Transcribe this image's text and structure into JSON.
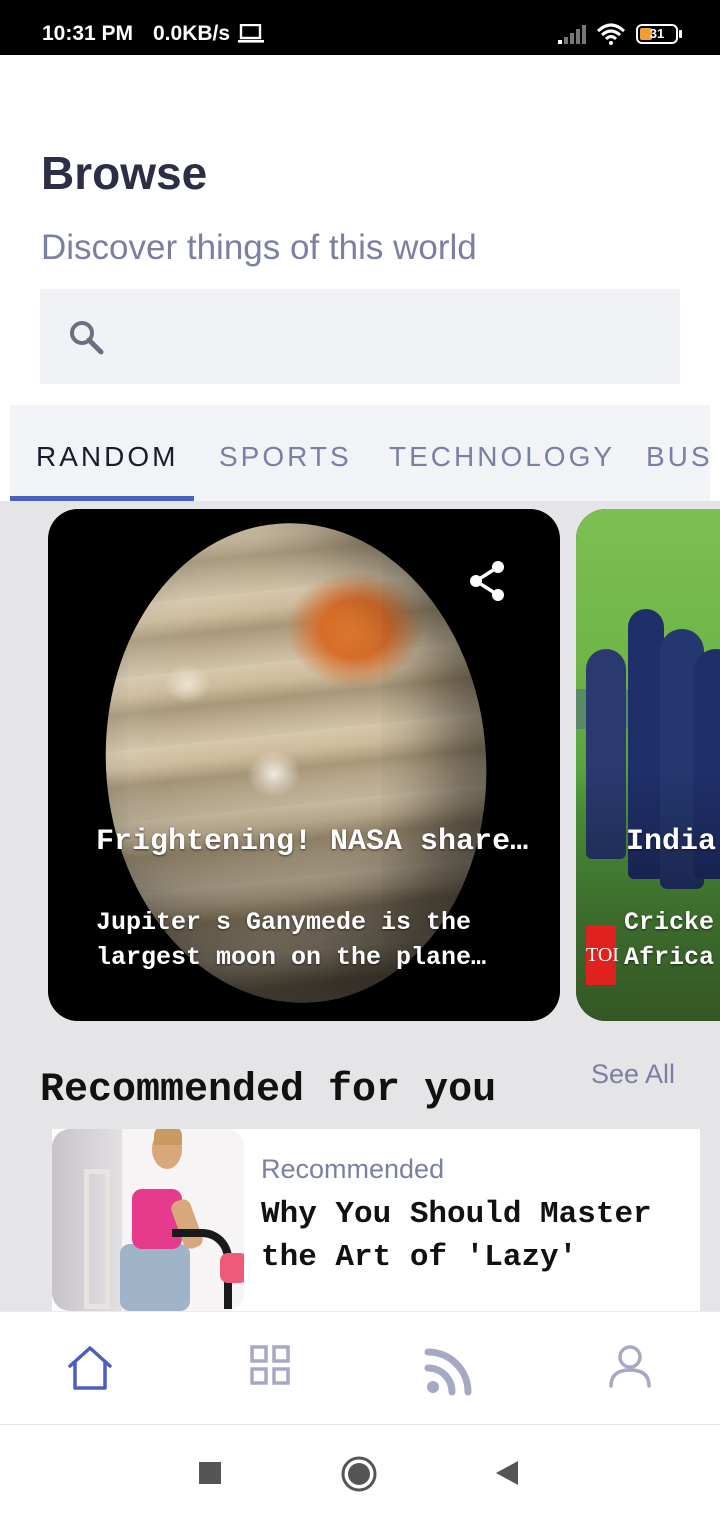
{
  "status_bar": {
    "time": "10:31 PM",
    "network_speed": "0.0KB/s",
    "battery": "31",
    "icons": [
      "laptop-icon",
      "signal-icon",
      "wifi-icon",
      "battery-icon"
    ]
  },
  "header": {
    "title": "Browse",
    "subtitle": "Discover things of this world"
  },
  "search": {
    "placeholder": "",
    "value": "",
    "icon": "search-icon"
  },
  "tabs": [
    {
      "label": "RANDOM",
      "active": true
    },
    {
      "label": "SPORTS",
      "active": false
    },
    {
      "label": "TECHNOLOGY",
      "active": false
    },
    {
      "label": "BUS",
      "active": false
    }
  ],
  "featured": [
    {
      "title": "Frightening! NASA share…",
      "description": "Jupiter s Ganymede is the largest moon on the plane…",
      "image": "jupiter-image",
      "share_icon": "share-icon"
    },
    {
      "title": "India",
      "description": "Cricke\nAfrica",
      "source_badge": "TOI",
      "image": "cricket-team-image"
    }
  ],
  "recommended": {
    "heading": "Recommended for you",
    "see_all": "See All",
    "items": [
      {
        "label": "Recommended",
        "title": "Why You Should Master the Art of 'Lazy'",
        "image": "exercise-bike-woman-image"
      }
    ]
  },
  "bottom_nav": [
    {
      "name": "home-icon",
      "active": true
    },
    {
      "name": "grid-icon",
      "active": false
    },
    {
      "name": "feed-icon",
      "active": false
    },
    {
      "name": "profile-icon",
      "active": false
    }
  ],
  "colors": {
    "accent": "#4a5fc1",
    "title": "#2b2e45",
    "muted": "#7a80a3",
    "background_gray": "#e5e5e7",
    "search_bg": "#f1f2f5"
  }
}
